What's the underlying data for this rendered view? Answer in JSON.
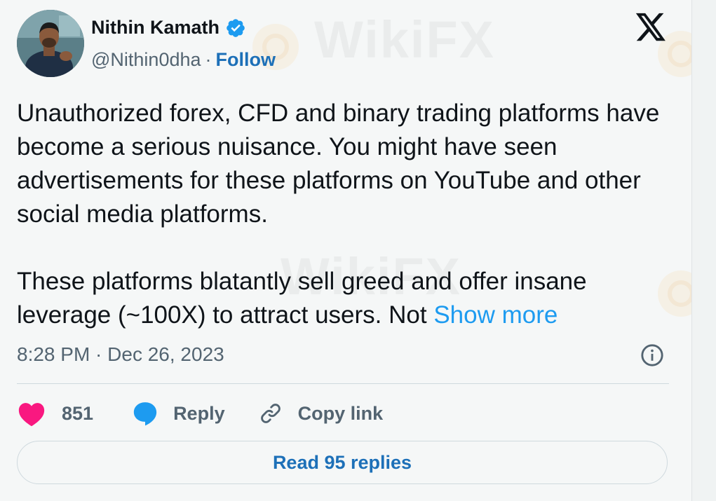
{
  "author": {
    "name": "Nithin Kamath",
    "handle": "@Nithin0dha",
    "separator": "·",
    "follow_label": "Follow",
    "verified": true
  },
  "platform_logo": "x-logo",
  "post": {
    "paragraph1": "Unauthorized forex, CFD and binary trading platforms have become a serious nuisance. You might have seen advertisements for these platforms on YouTube and other social media platforms.",
    "paragraph2": "These platforms blatantly sell greed and offer insane leverage (~100X) to attract users. Not",
    "show_more_label": "Show more",
    "timestamp": "8:28 PM · Dec 26, 2023"
  },
  "actions": {
    "like_count": "851",
    "reply_label": "Reply",
    "copy_link_label": "Copy link"
  },
  "read_replies_label": "Read 95 replies",
  "watermark": "WikiFX",
  "colors": {
    "like": "#f91880",
    "reply_bubble": "#1d9bf0",
    "link_blue": "#1d70b8",
    "show_more": "#1d9bf0",
    "verified": "#1d9bf0",
    "muted": "#536471"
  }
}
